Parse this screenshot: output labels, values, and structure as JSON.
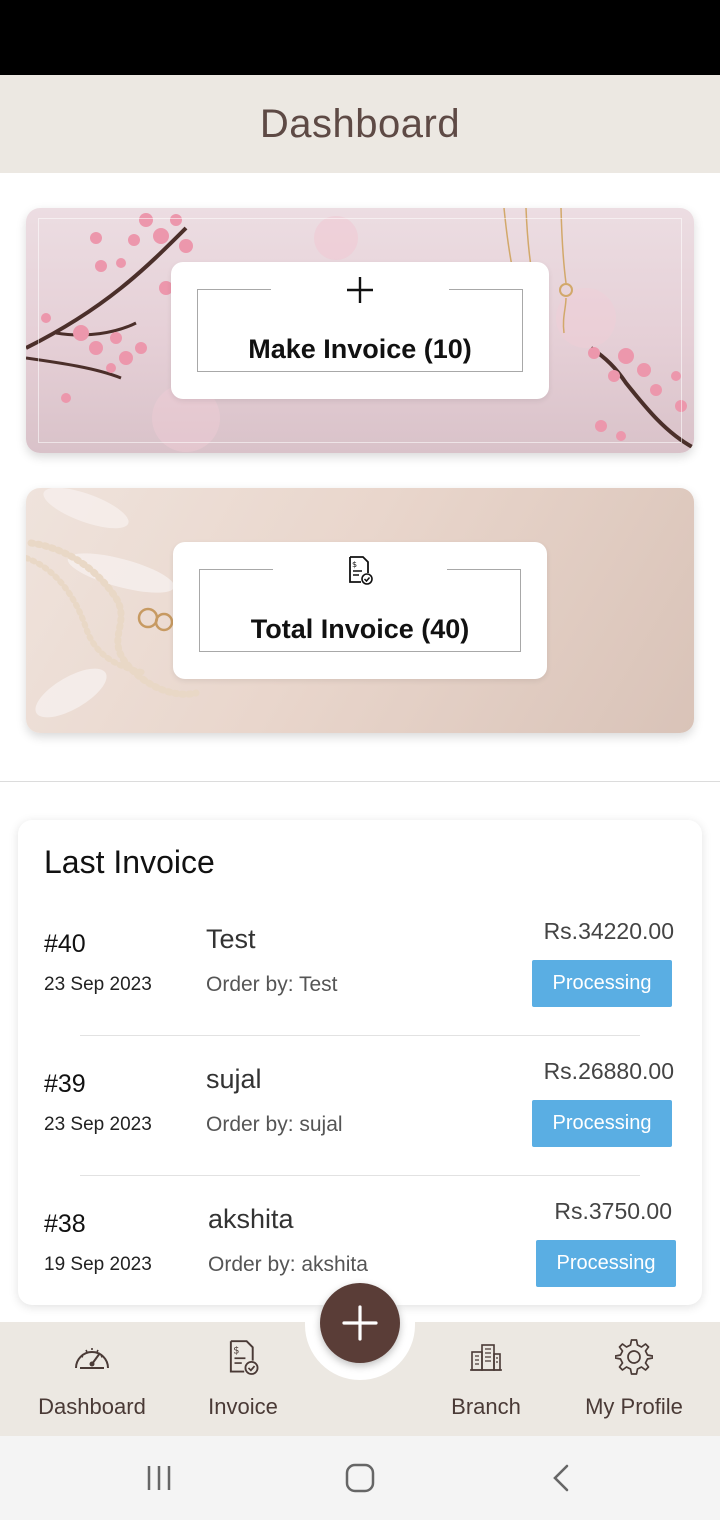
{
  "header": {
    "title": "Dashboard"
  },
  "cards": {
    "make_invoice": {
      "label": "Make Invoice (10)",
      "icon": "plus-icon"
    },
    "total_invoice": {
      "label": "Total Invoice (40)",
      "icon": "invoice-check-icon"
    }
  },
  "last_invoice": {
    "heading": "Last Invoice",
    "rows": [
      {
        "number": "#40",
        "date": "23 Sep 2023",
        "customer": "Test",
        "order_by": "Order by: Test",
        "amount": "Rs.34220.00",
        "status": "Processing"
      },
      {
        "number": "#39",
        "date": "23 Sep 2023",
        "customer": "sujal",
        "order_by": "Order by: sujal",
        "amount": "Rs.26880.00",
        "status": "Processing"
      },
      {
        "number": "#38",
        "date": "19 Sep 2023",
        "customer": "akshita",
        "order_by": "Order by: akshita",
        "amount": "Rs.3750.00",
        "status": "Processing"
      }
    ]
  },
  "bottom_nav": {
    "items": [
      {
        "label": "Dashboard",
        "icon": "speedometer-icon"
      },
      {
        "label": "Invoice",
        "icon": "invoice-icon"
      },
      {
        "label": "Branch",
        "icon": "building-icon"
      },
      {
        "label": "My Profile",
        "icon": "gear-icon"
      }
    ],
    "fab_icon": "plus-icon"
  },
  "system_nav": {
    "icons": [
      "recents-icon",
      "home-icon",
      "back-icon"
    ]
  },
  "colors": {
    "header_bg": "#ece8e2",
    "title_color": "#5e4a45",
    "status_badge": "#5aaee3",
    "fab_bg": "#5a3d37"
  }
}
